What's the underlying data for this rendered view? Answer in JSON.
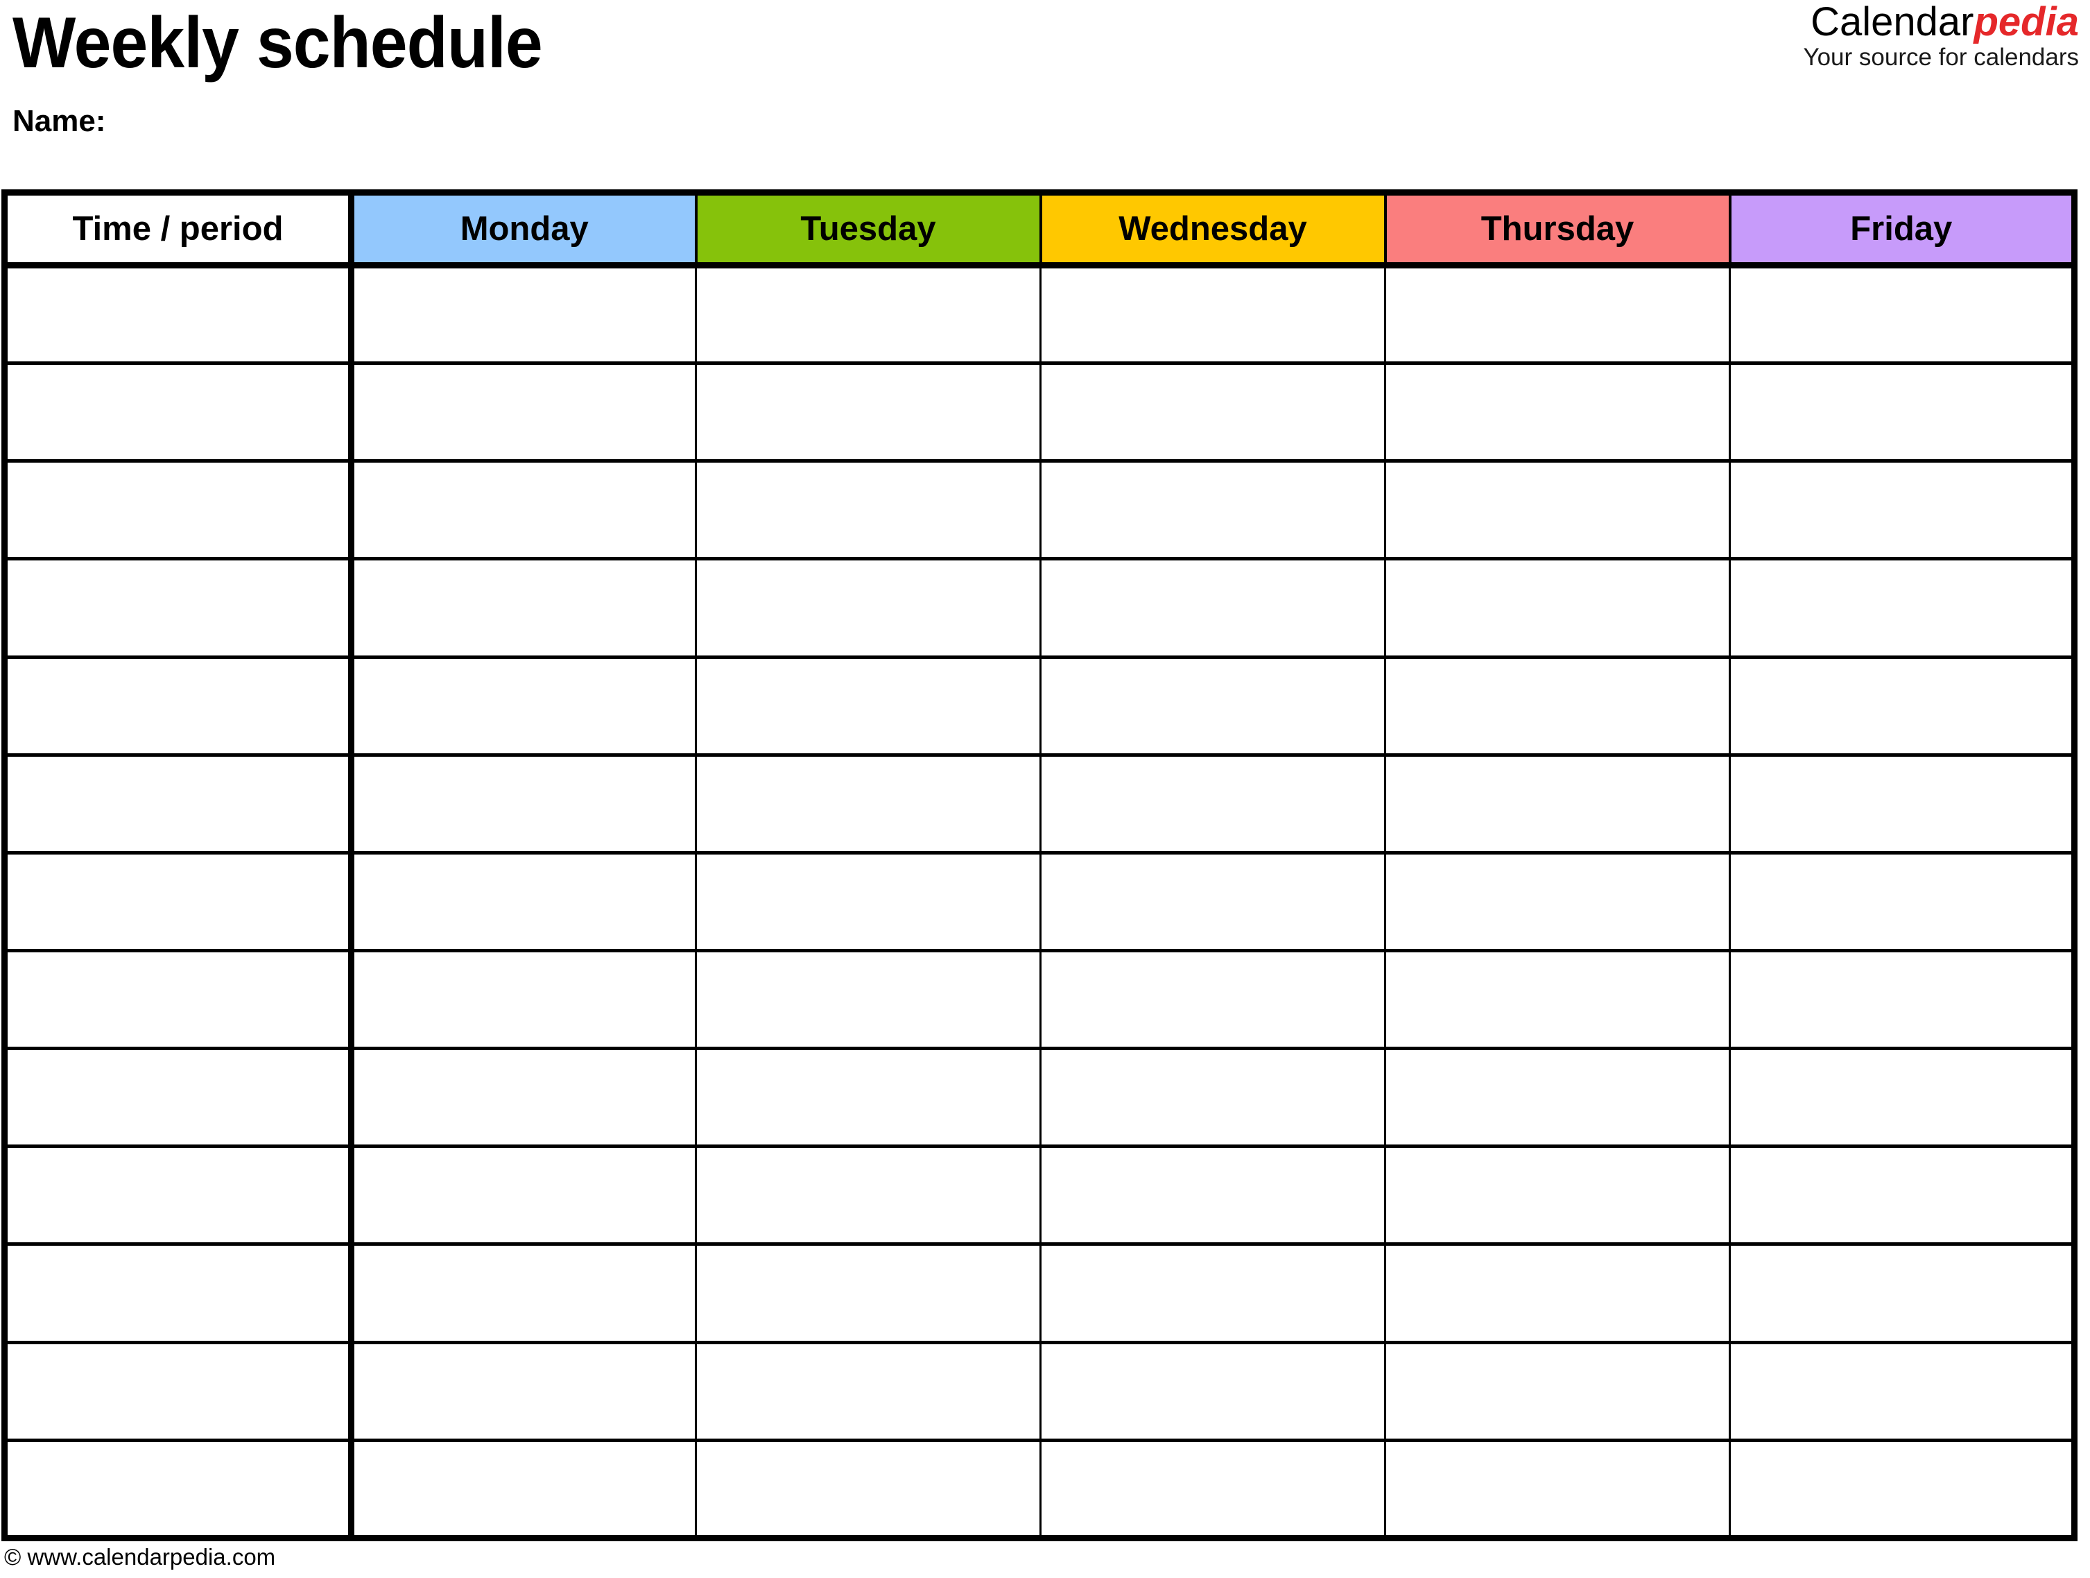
{
  "document": {
    "title": "Weekly schedule",
    "name_label": "Name:"
  },
  "brand": {
    "word_main": "Calendar",
    "word_accent": "pedia",
    "tagline": "Your source for calendars",
    "accent_color": "#e5282a"
  },
  "table": {
    "columns": [
      {
        "label": "Time / period",
        "bg": "#ffffff"
      },
      {
        "label": "Monday",
        "bg": "#93c8fd"
      },
      {
        "label": "Tuesday",
        "bg": "#86c20b"
      },
      {
        "label": "Wednesday",
        "bg": "#ffc800"
      },
      {
        "label": "Thursday",
        "bg": "#fa7e7e"
      },
      {
        "label": "Friday",
        "bg": "#c79bfa"
      }
    ],
    "row_count": 13,
    "rows": [
      {
        "time": "",
        "cells": [
          "",
          "",
          "",
          "",
          ""
        ]
      },
      {
        "time": "",
        "cells": [
          "",
          "",
          "",
          "",
          ""
        ]
      },
      {
        "time": "",
        "cells": [
          "",
          "",
          "",
          "",
          ""
        ]
      },
      {
        "time": "",
        "cells": [
          "",
          "",
          "",
          "",
          ""
        ]
      },
      {
        "time": "",
        "cells": [
          "",
          "",
          "",
          "",
          ""
        ]
      },
      {
        "time": "",
        "cells": [
          "",
          "",
          "",
          "",
          ""
        ]
      },
      {
        "time": "",
        "cells": [
          "",
          "",
          "",
          "",
          ""
        ]
      },
      {
        "time": "",
        "cells": [
          "",
          "",
          "",
          "",
          ""
        ]
      },
      {
        "time": "",
        "cells": [
          "",
          "",
          "",
          "",
          ""
        ]
      },
      {
        "time": "",
        "cells": [
          "",
          "",
          "",
          "",
          ""
        ]
      },
      {
        "time": "",
        "cells": [
          "",
          "",
          "",
          "",
          ""
        ]
      },
      {
        "time": "",
        "cells": [
          "",
          "",
          "",
          "",
          ""
        ]
      },
      {
        "time": "",
        "cells": [
          "",
          "",
          "",
          "",
          ""
        ]
      }
    ]
  },
  "footer": {
    "credit": "© www.calendarpedia.com"
  }
}
